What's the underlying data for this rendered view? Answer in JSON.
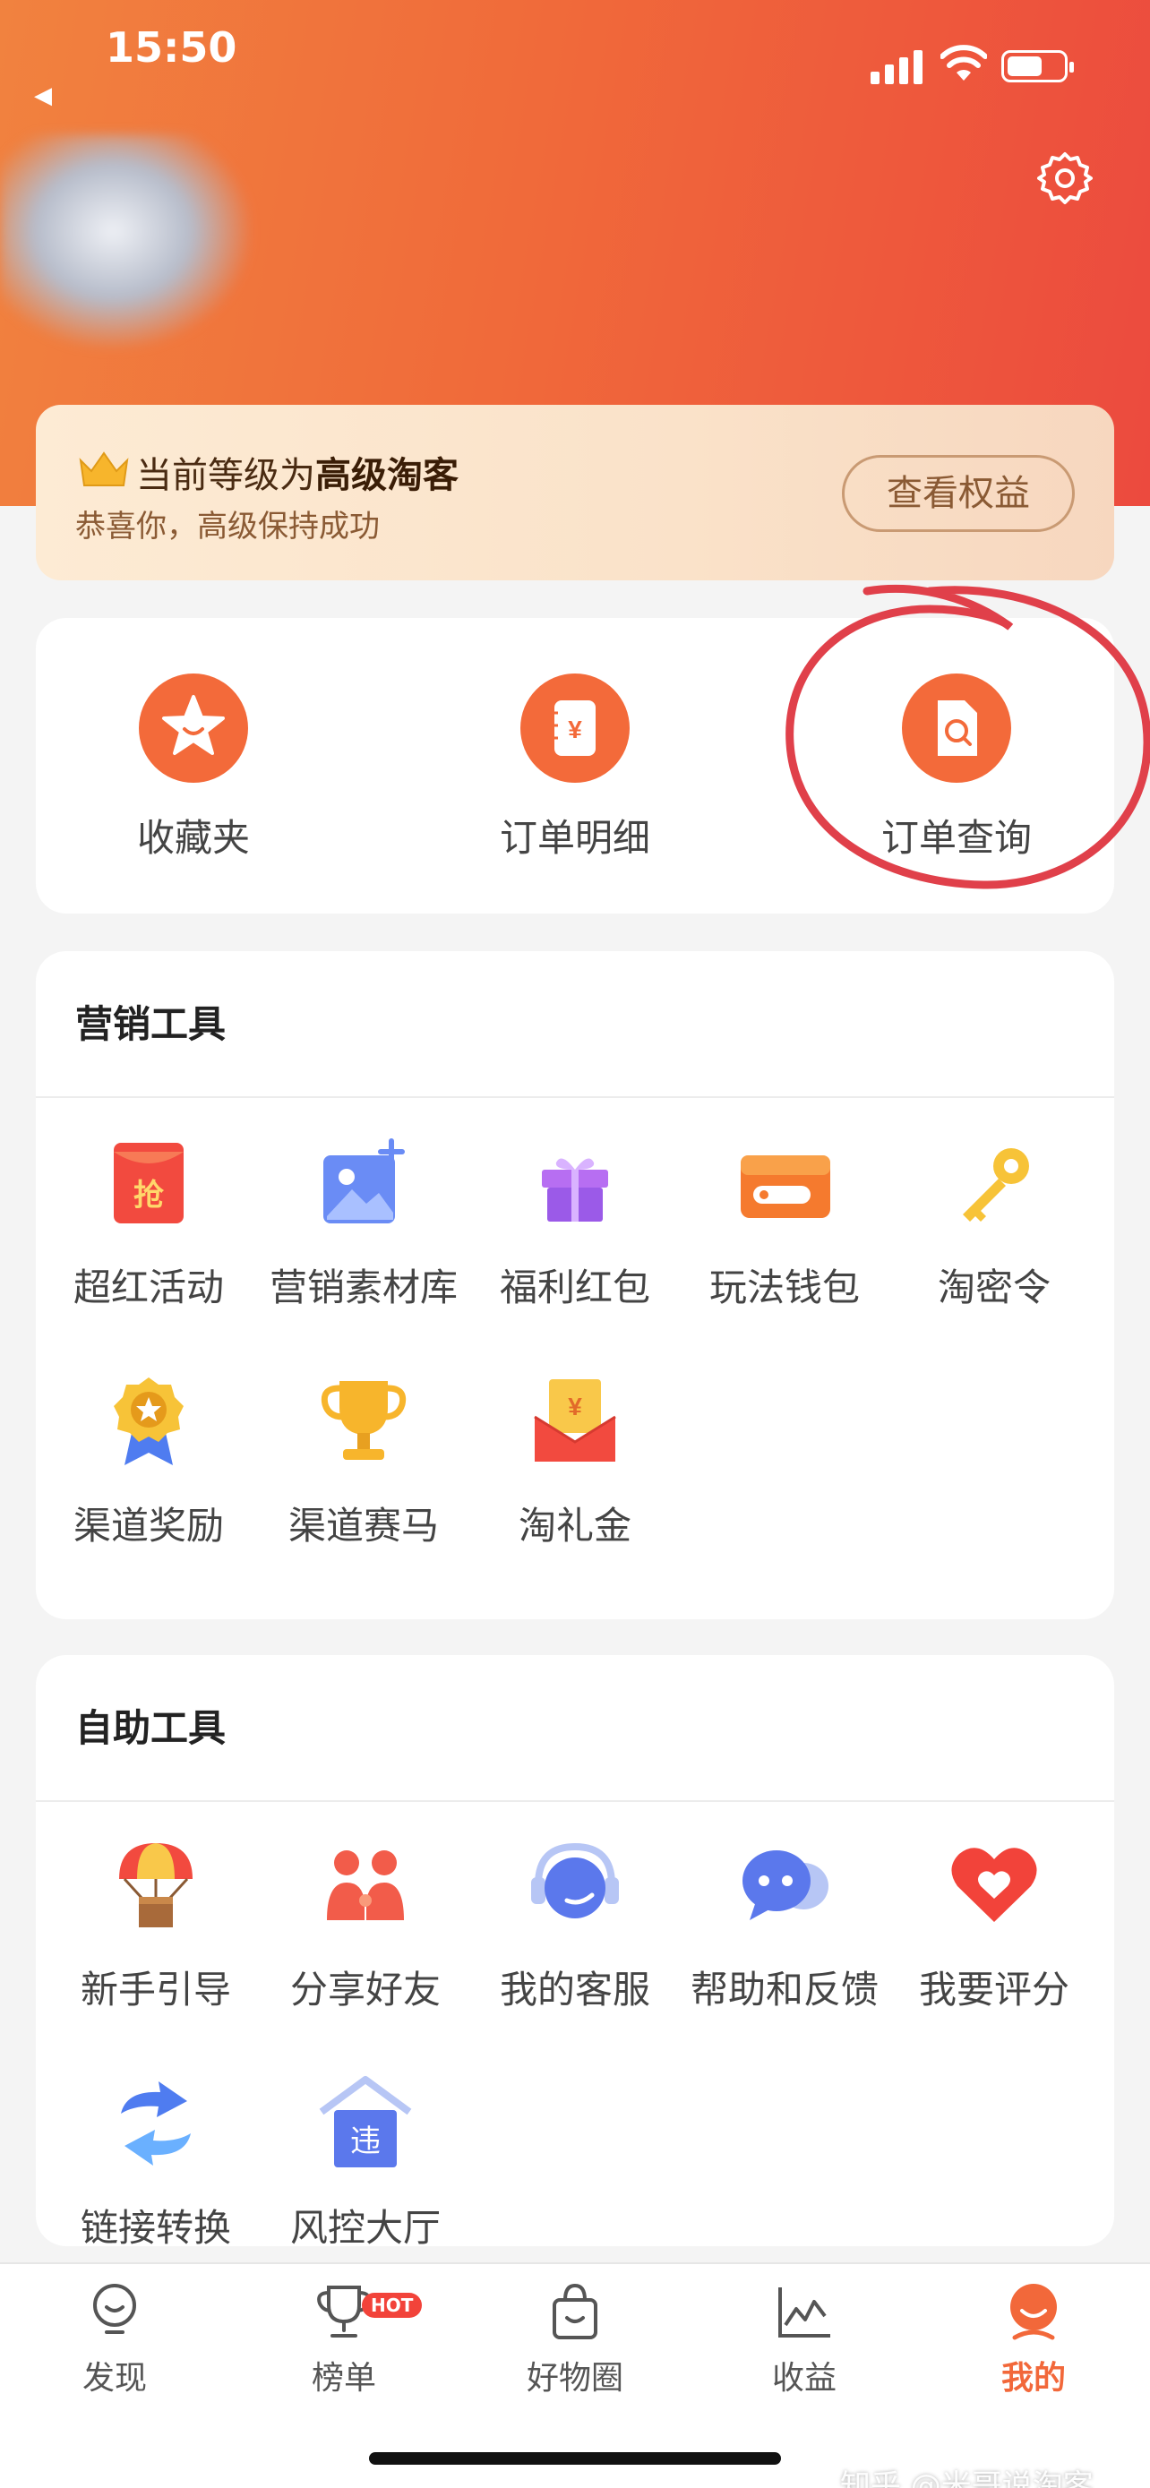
{
  "status_bar": {
    "time": "15:50"
  },
  "level_card": {
    "title_prefix": "当前等级为",
    "title_level": "高级淘客",
    "subtitle": "恭喜你，高级保持成功",
    "button": "查看权益"
  },
  "orders": [
    {
      "label": "收藏夹",
      "icon": "star-icon"
    },
    {
      "label": "订单明细",
      "icon": "yuan-note-icon"
    },
    {
      "label": "订单查询",
      "icon": "document-search-icon"
    }
  ],
  "marketing": {
    "title": "营销工具",
    "tools": [
      {
        "label": "超红活动",
        "icon": "red-envelope-icon",
        "glyph": "抢"
      },
      {
        "label": "营销素材库",
        "icon": "image-plus-icon"
      },
      {
        "label": "福利红包",
        "icon": "gift-icon"
      },
      {
        "label": "玩法钱包",
        "icon": "wallet-icon"
      },
      {
        "label": "淘密令",
        "icon": "key-icon"
      },
      {
        "label": "渠道奖励",
        "icon": "medal-icon"
      },
      {
        "label": "渠道赛马",
        "icon": "trophy-icon"
      },
      {
        "label": "淘礼金",
        "icon": "cash-envelope-icon",
        "glyph": "¥"
      }
    ]
  },
  "selfhelp": {
    "title": "自助工具",
    "tools": [
      {
        "label": "新手引导",
        "icon": "parachute-box-icon"
      },
      {
        "label": "分享好友",
        "icon": "friends-icon"
      },
      {
        "label": "我的客服",
        "icon": "headset-icon"
      },
      {
        "label": "帮助和反馈",
        "icon": "chat-bubbles-icon"
      },
      {
        "label": "我要评分",
        "icon": "heart-icon"
      },
      {
        "label": "链接转换",
        "icon": "exchange-arrows-icon"
      },
      {
        "label": "风控大厅",
        "icon": "risk-house-icon",
        "glyph": "违"
      }
    ]
  },
  "tabbar": {
    "tabs": [
      {
        "label": "发现",
        "icon": "lightbulb-icon"
      },
      {
        "label": "榜单",
        "icon": "trophy-tab-icon",
        "badge": "HOT"
      },
      {
        "label": "好物圈",
        "icon": "shopping-bag-icon"
      },
      {
        "label": "收益",
        "icon": "chart-line-icon"
      },
      {
        "label": "我的",
        "icon": "profile-face-icon",
        "active": true
      }
    ]
  },
  "watermark": "知乎 @米哥说淘客",
  "colors": {
    "accent": "#f2683a",
    "header_start": "#f1823f",
    "header_end": "#ec4a3e",
    "annotation": "#e0404a"
  }
}
